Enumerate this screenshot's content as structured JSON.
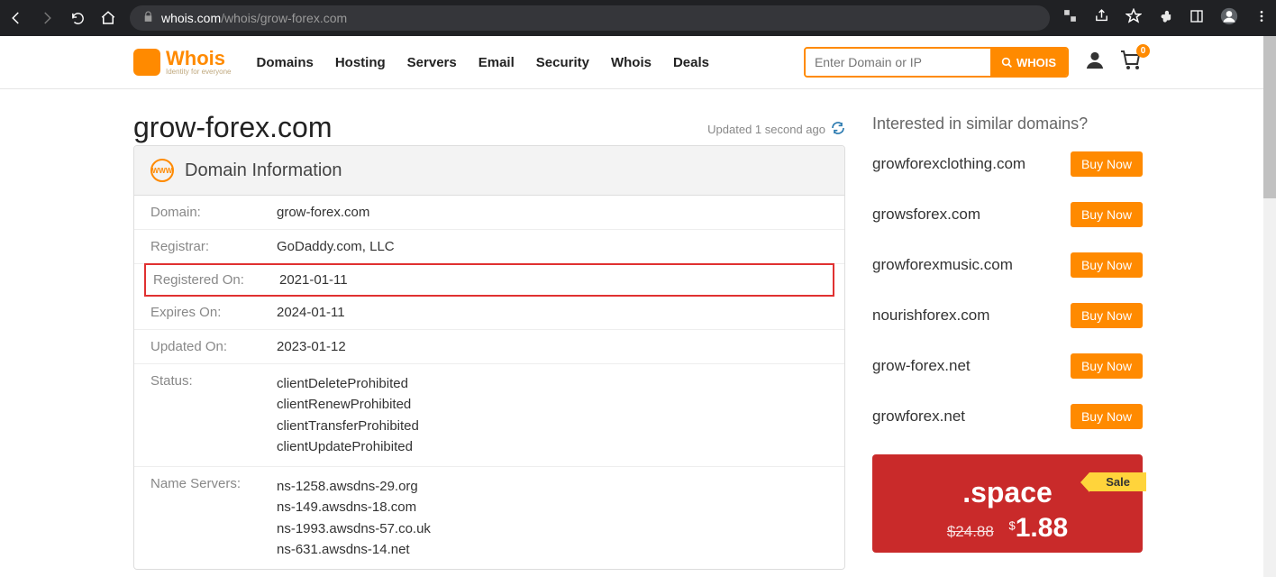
{
  "browser": {
    "url_host": "whois.com",
    "url_path": "/whois/grow-forex.com"
  },
  "logo": {
    "text_big": "Whois",
    "text_small": "Identity for everyone"
  },
  "nav": [
    "Domains",
    "Hosting",
    "Servers",
    "Email",
    "Security",
    "Whois",
    "Deals"
  ],
  "search": {
    "placeholder": "Enter Domain or IP",
    "button": "WHOIS"
  },
  "cart_count": "0",
  "domain_title": "grow-forex.com",
  "updated_text": "Updated 1 second ago",
  "card_title": "Domain Information",
  "rows": {
    "domain": {
      "label": "Domain:",
      "value": "grow-forex.com"
    },
    "registrar": {
      "label": "Registrar:",
      "value": "GoDaddy.com, LLC"
    },
    "registered": {
      "label": "Registered On:",
      "value": "2021-01-11"
    },
    "expires": {
      "label": "Expires On:",
      "value": "2024-01-11"
    },
    "updated": {
      "label": "Updated On:",
      "value": "2023-01-12"
    },
    "status": {
      "label": "Status:",
      "v0": "clientDeleteProhibited",
      "v1": "clientRenewProhibited",
      "v2": "clientTransferProhibited",
      "v3": "clientUpdateProhibited"
    },
    "ns": {
      "label": "Name Servers:",
      "v0": "ns-1258.awsdns-29.org",
      "v1": "ns-149.awsdns-18.com",
      "v2": "ns-1993.awsdns-57.co.uk",
      "v3": "ns-631.awsdns-14.net"
    }
  },
  "side_title": "Interested in similar domains?",
  "similar": {
    "buy_label": "Buy Now",
    "d0": "growforexclothing.com",
    "d1": "growsforex.com",
    "d2": "growforexmusic.com",
    "d3": "nourishforex.com",
    "d4": "grow-forex.net",
    "d5": "growforex.net"
  },
  "promo": {
    "sale": "Sale",
    "tld": ".space",
    "old_price": "$24.88",
    "new_dollar": "$",
    "new_price": "1.88"
  }
}
